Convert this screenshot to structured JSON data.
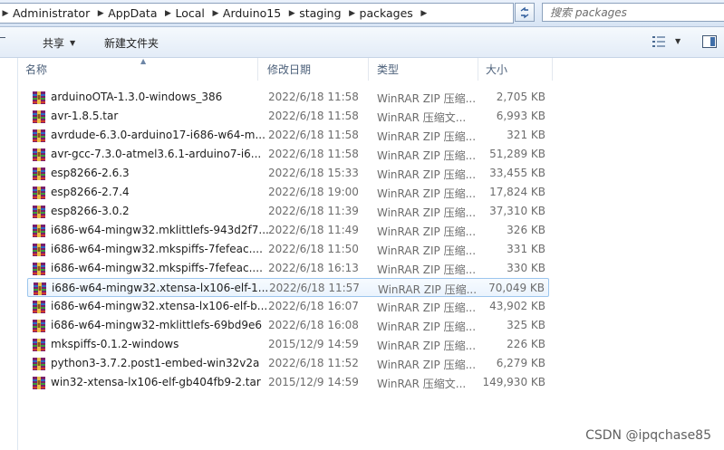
{
  "address": {
    "crumbs": [
      "Administrator",
      "AppData",
      "Local",
      "Arduino15",
      "staging",
      "packages"
    ]
  },
  "search": {
    "placeholder": "搜索 packages"
  },
  "toolbar": {
    "share_label": "共享",
    "new_folder_label": "新建文件夹"
  },
  "columns": {
    "name": "名称",
    "date": "修改日期",
    "type": "类型",
    "size": "大小"
  },
  "files": [
    {
      "name": "arduinoOTA-1.3.0-windows_386",
      "date": "2022/6/18 11:58",
      "type": "WinRAR ZIP 压缩...",
      "size": "2,705 KB"
    },
    {
      "name": "avr-1.8.5.tar",
      "date": "2022/6/18 11:58",
      "type": "WinRAR 压缩文...",
      "size": "6,993 KB"
    },
    {
      "name": "avrdude-6.3.0-arduino17-i686-w64-m...",
      "date": "2022/6/18 11:58",
      "type": "WinRAR ZIP 压缩...",
      "size": "321 KB"
    },
    {
      "name": "avr-gcc-7.3.0-atmel3.6.1-arduino7-i6...",
      "date": "2022/6/18 11:58",
      "type": "WinRAR ZIP 压缩...",
      "size": "51,289 KB"
    },
    {
      "name": "esp8266-2.6.3",
      "date": "2022/6/18 15:33",
      "type": "WinRAR ZIP 压缩...",
      "size": "33,455 KB"
    },
    {
      "name": "esp8266-2.7.4",
      "date": "2022/6/18 19:00",
      "type": "WinRAR ZIP 压缩...",
      "size": "17,824 KB"
    },
    {
      "name": "esp8266-3.0.2",
      "date": "2022/6/18 11:39",
      "type": "WinRAR ZIP 压缩...",
      "size": "37,310 KB"
    },
    {
      "name": "i686-w64-mingw32.mklittlefs-943d2f7...",
      "date": "2022/6/18 11:49",
      "type": "WinRAR ZIP 压缩...",
      "size": "326 KB"
    },
    {
      "name": "i686-w64-mingw32.mkspiffs-7fefeac....",
      "date": "2022/6/18 11:50",
      "type": "WinRAR ZIP 压缩...",
      "size": "331 KB"
    },
    {
      "name": "i686-w64-mingw32.mkspiffs-7fefeac....",
      "date": "2022/6/18 16:13",
      "type": "WinRAR ZIP 压缩...",
      "size": "330 KB"
    },
    {
      "name": "i686-w64-mingw32.xtensa-lx106-elf-1...",
      "date": "2022/6/18 11:57",
      "type": "WinRAR ZIP 压缩...",
      "size": "70,049 KB",
      "selected": true
    },
    {
      "name": "i686-w64-mingw32.xtensa-lx106-elf-b...",
      "date": "2022/6/18 16:07",
      "type": "WinRAR ZIP 压缩...",
      "size": "43,902 KB"
    },
    {
      "name": "i686-w64-mingw32-mklittlefs-69bd9e6",
      "date": "2022/6/18 16:08",
      "type": "WinRAR ZIP 压缩...",
      "size": "325 KB"
    },
    {
      "name": "mkspiffs-0.1.2-windows",
      "date": "2015/12/9 14:59",
      "type": "WinRAR ZIP 压缩...",
      "size": "226 KB"
    },
    {
      "name": "python3-3.7.2.post1-embed-win32v2a",
      "date": "2022/6/18 11:52",
      "type": "WinRAR ZIP 压缩...",
      "size": "6,279 KB"
    },
    {
      "name": "win32-xtensa-lx106-elf-gb404fb9-2.tar",
      "date": "2015/12/9 14:59",
      "type": "WinRAR 压缩文...",
      "size": "149,930 KB"
    }
  ],
  "icons": {
    "file": "winrar-archive-icon",
    "refresh": "refresh-icon",
    "view": "view-options-icon",
    "pane": "preview-pane-icon"
  },
  "colors": {
    "selection_border": "#9cc6ee",
    "selection_fill": "#eaf3fd",
    "header_text": "#4c607a"
  },
  "watermark": "CSDN @ipqchase85"
}
